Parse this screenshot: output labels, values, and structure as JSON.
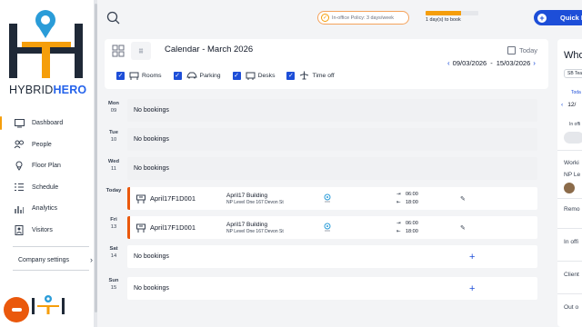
{
  "brand": {
    "name_left": "HYBRID",
    "name_right": "HERO"
  },
  "nav": [
    {
      "label": "Dashboard",
      "icon": "dashboard-icon"
    },
    {
      "label": "People",
      "icon": "people-icon"
    },
    {
      "label": "Floor Plan",
      "icon": "floor-plan-icon"
    },
    {
      "label": "Schedule",
      "icon": "schedule-icon"
    },
    {
      "label": "Analytics",
      "icon": "analytics-icon"
    },
    {
      "label": "Visitors",
      "icon": "visitors-icon"
    }
  ],
  "company_settings": "Company settings",
  "topbar": {
    "policy": "In-office Policy: 3 days/week",
    "progress_label": "1 day(s) to book",
    "progress_fraction": 0.67,
    "quick_label": "Quick B"
  },
  "calendar": {
    "title": "Calendar - March 2026",
    "today_label": "Today",
    "range_start": "09/03/2026",
    "range_sep": "-",
    "range_end": "15/03/2026",
    "filters": [
      "Rooms",
      "Parking",
      "Desks",
      "Time off"
    ]
  },
  "days": [
    {
      "day": "Mon",
      "date": "09",
      "no_bookings": "No bookings"
    },
    {
      "day": "Tue",
      "date": "10",
      "no_bookings": "No bookings"
    },
    {
      "day": "Wed",
      "date": "11",
      "no_bookings": "No bookings"
    },
    {
      "day": "Today",
      "date": "",
      "desk": "April17F1D001",
      "building": "April17 Building",
      "address": "NP Level One 167 Devon St",
      "time_in": "06:00",
      "time_out": "18:00"
    },
    {
      "day": "Fri",
      "date": "13",
      "desk": "April17F1D001",
      "building": "April17 Building",
      "address": "NP Level One 167 Devon St",
      "time_in": "06:00",
      "time_out": "18:00"
    },
    {
      "day": "Sat",
      "date": "14",
      "no_bookings": "No bookings"
    },
    {
      "day": "Sun",
      "date": "15",
      "no_bookings": "No bookings"
    }
  ],
  "right_panel": {
    "title": "Who",
    "team": "SB Tea",
    "today": "Toda",
    "date": "12/",
    "in_office": "In offi",
    "working": "Worki",
    "np_level": "NP Le",
    "remote": "Remo",
    "in_office2": "In offi",
    "client": "Client",
    "out_of": "Out o"
  },
  "colors": {
    "accent": "#f59e0b",
    "primary": "#1d4ed8",
    "booking_border": "#ea580c"
  }
}
